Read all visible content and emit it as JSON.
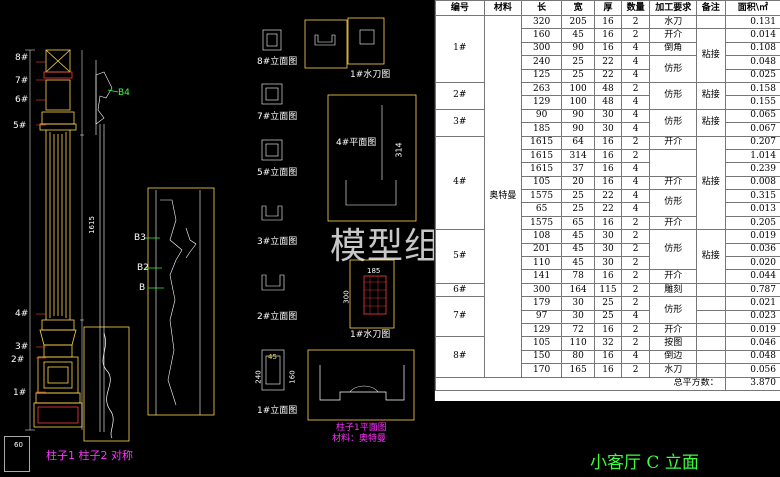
{
  "drawing": {
    "watermark": "模型组",
    "sheet_title": "小客厅 C 立面",
    "column_caption": "柱子1 柱子2 对称",
    "labels": {
      "l8top": "8#",
      "l7top": "7#",
      "l6top": "6#",
      "l5top": "5#",
      "l4": "4#",
      "l3": "3#",
      "l2": "2#",
      "l1": "1#",
      "b4": "B4",
      "b3": "B3",
      "b2": "B2",
      "b1": "B",
      "dim1": "1615",
      "dim2": "125",
      "dim3": "60"
    },
    "views": {
      "v8": "8#立面图",
      "v1knife": "1#水刀图",
      "v7": "7#立面图",
      "v6": "6#立面图",
      "v5": "5#立面图",
      "v3": "3#立面图",
      "v2": "2#立面图",
      "v1knife2": "1#水刀图",
      "v1": "1#立面图",
      "v4plan": "4#平面图",
      "v1plan": "柱子1平面图",
      "material": "材料：奥特曼"
    },
    "dims": {
      "d314": "314",
      "d185": "185",
      "d300": "300",
      "d125": "125",
      "d240": "240",
      "d45": "45",
      "d160": "160",
      "d64": "64"
    }
  },
  "table": {
    "headers": [
      "编号",
      "材料",
      "长",
      "宽",
      "厚",
      "数量",
      "加工要求",
      "备注",
      "面积\\㎡"
    ],
    "material": "奥特曼",
    "remark": "粘接",
    "rows": [
      {
        "len": "320",
        "wid": "205",
        "thk": "16",
        "qty": "2",
        "req": "水刀",
        "area": "0.131"
      },
      {
        "len": "160",
        "wid": "45",
        "thk": "16",
        "qty": "2",
        "req": "开介",
        "area": "0.014"
      },
      {
        "len": "300",
        "wid": "90",
        "thk": "16",
        "qty": "4",
        "req": "倒角",
        "area": "0.108"
      },
      {
        "len": "240",
        "wid": "25",
        "thk": "22",
        "qty": "4",
        "req": "仿形",
        "area": "0.048"
      },
      {
        "len": "125",
        "wid": "25",
        "thk": "22",
        "qty": "4",
        "req": "",
        "area": "0.025"
      },
      {
        "len": "263",
        "wid": "100",
        "thk": "48",
        "qty": "2",
        "req": "仿形",
        "area": "0.158"
      },
      {
        "len": "129",
        "wid": "100",
        "thk": "48",
        "qty": "4",
        "req": "",
        "area": "0.155"
      },
      {
        "len": "90",
        "wid": "90",
        "thk": "30",
        "qty": "4",
        "req": "仿形",
        "area": "0.065"
      },
      {
        "len": "185",
        "wid": "90",
        "thk": "30",
        "qty": "4",
        "req": "",
        "area": "0.067"
      },
      {
        "len": "1615",
        "wid": "64",
        "thk": "16",
        "qty": "2",
        "req": "开介",
        "area": "0.207"
      },
      {
        "len": "1615",
        "wid": "314",
        "thk": "16",
        "qty": "2",
        "req": "",
        "area": "1.014"
      },
      {
        "len": "1615",
        "wid": "37",
        "thk": "16",
        "qty": "4",
        "req": "仿形",
        "area": "0.239"
      },
      {
        "len": "105",
        "wid": "20",
        "thk": "16",
        "qty": "4",
        "req": "开介",
        "area": "0.008"
      },
      {
        "len": "1575",
        "wid": "25",
        "thk": "22",
        "qty": "4",
        "req": "仿形",
        "area": "0.315"
      },
      {
        "len": "65",
        "wid": "25",
        "thk": "22",
        "qty": "4",
        "req": "",
        "area": "0.013"
      },
      {
        "len": "1575",
        "wid": "65",
        "thk": "16",
        "qty": "2",
        "req": "开介",
        "area": "0.205"
      },
      {
        "len": "108",
        "wid": "45",
        "thk": "30",
        "qty": "2",
        "req": "仿形",
        "area": "0.019"
      },
      {
        "len": "201",
        "wid": "45",
        "thk": "30",
        "qty": "2",
        "req": "",
        "area": "0.036"
      },
      {
        "len": "110",
        "wid": "45",
        "thk": "30",
        "qty": "2",
        "req": "",
        "area": "0.020"
      },
      {
        "len": "141",
        "wid": "78",
        "thk": "16",
        "qty": "2",
        "req": "开介",
        "area": "0.044"
      },
      {
        "len": "300",
        "wid": "164",
        "thk": "115",
        "qty": "2",
        "req": "雕刻",
        "area": "0.787"
      },
      {
        "len": "179",
        "wid": "30",
        "thk": "25",
        "qty": "2",
        "req": "仿形",
        "area": "0.021"
      },
      {
        "len": "97",
        "wid": "30",
        "thk": "25",
        "qty": "4",
        "req": "",
        "area": "0.023"
      },
      {
        "len": "129",
        "wid": "72",
        "thk": "16",
        "qty": "2",
        "req": "开介",
        "area": "0.019"
      },
      {
        "len": "105",
        "wid": "110",
        "thk": "32",
        "qty": "2",
        "req": "按图",
        "area": "0.046"
      },
      {
        "len": "150",
        "wid": "80",
        "thk": "16",
        "qty": "4",
        "req": "倒边",
        "area": "0.048"
      },
      {
        "len": "170",
        "wid": "165",
        "thk": "16",
        "qty": "2",
        "req": "水刀",
        "area": "0.056"
      }
    ],
    "ids": [
      "1#",
      "2#",
      "3#",
      "4#",
      "5#",
      "6#",
      "7#",
      "8#"
    ],
    "total_label": "总平方数：",
    "total_value": "3.870"
  },
  "colors": {
    "bg": "#000000",
    "line": "#ffd84a",
    "dim": "#ffffff",
    "accent": "#3dff3d",
    "magenta": "#ff30ff"
  }
}
